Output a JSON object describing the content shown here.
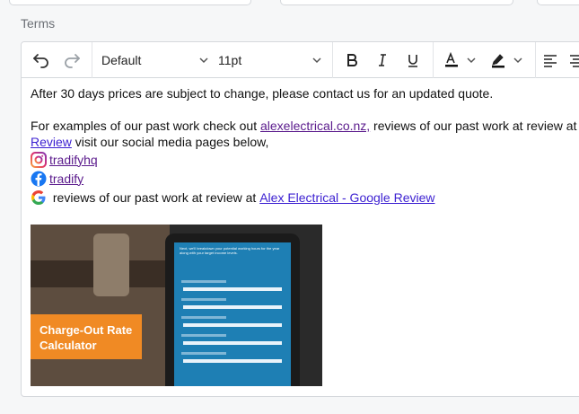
{
  "section_label": "Terms",
  "toolbar": {
    "font_family": "Default",
    "font_size": "11pt",
    "icons": [
      "undo-icon",
      "redo-icon",
      "bold-icon",
      "italic-icon",
      "underline-icon",
      "text-color-icon",
      "highlight-icon",
      "align-left-icon",
      "align-center-icon"
    ],
    "text_color": "#111111",
    "highlight_color": "#111111"
  },
  "content": {
    "para1": "After 30 days prices are subject to change, please contact us for an updated quote.",
    "para2_prefix": "For examples of our past work check out ",
    "para2_link": "alexelectrical.co.nz,",
    "para2_suffix": " reviews of our past work at review at Alex Electrical - Google",
    "para3_link": "Review",
    "para3_suffix": " visit our social media pages below,",
    "instagram_link": "tradifyhq",
    "facebook_link": "tradify",
    "google_prefix": " reviews of our past work at review at ",
    "google_link": "Alex Electrical - Google Review"
  },
  "image": {
    "callout": "Charge-Out Rate Calculator",
    "screen_heading": "Next, we'll breakdown your potential working hours for the year along with your target income levels."
  },
  "colors": {
    "link": "#3b1fd1",
    "link_visited": "#5a1a8c",
    "callout_bg": "#f08a24",
    "screen_bg": "#1e7fb4"
  }
}
